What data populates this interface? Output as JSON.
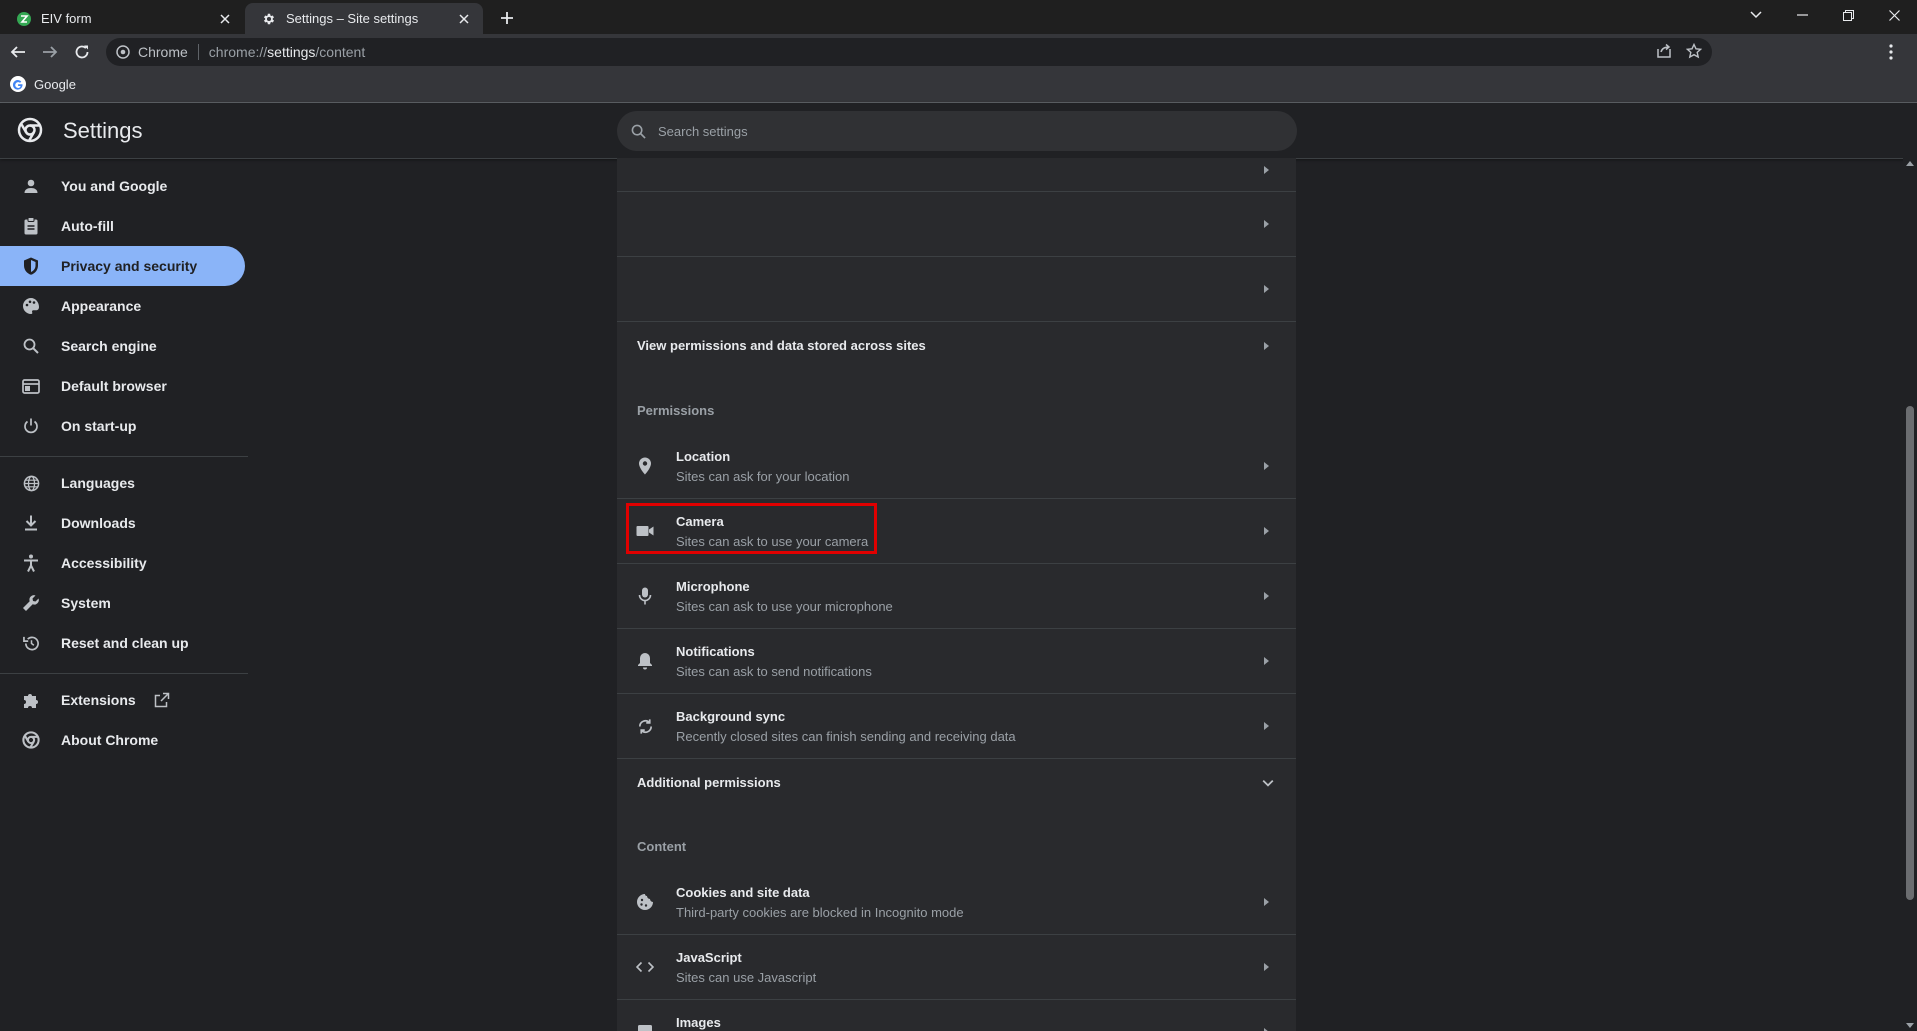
{
  "browser": {
    "tabs": [
      {
        "title": "EIV form",
        "favicon": "eiv-form-icon",
        "active": false
      },
      {
        "title": "Settings – Site settings",
        "favicon": "gear-icon",
        "active": true
      }
    ],
    "omnibox": {
      "chip_label": "Chrome",
      "url_scheme": "chrome://",
      "url_host": "settings",
      "url_path": "/content"
    },
    "bookmarks": [
      {
        "label": "Google",
        "icon": "google-icon"
      }
    ]
  },
  "settings": {
    "title": "Settings",
    "search_placeholder": "Search settings"
  },
  "sidebar": {
    "items": [
      {
        "label": "You and Google",
        "icon": "person-icon"
      },
      {
        "label": "Auto-fill",
        "icon": "clipboard-icon"
      },
      {
        "label": "Privacy and security",
        "icon": "shield-icon",
        "selected": true
      },
      {
        "label": "Appearance",
        "icon": "palette-icon"
      },
      {
        "label": "Search engine",
        "icon": "search-icon"
      },
      {
        "label": "Default browser",
        "icon": "browser-icon"
      },
      {
        "label": "On start-up",
        "icon": "power-icon"
      },
      {
        "label": "Languages",
        "icon": "globe-icon"
      },
      {
        "label": "Downloads",
        "icon": "download-icon"
      },
      {
        "label": "Accessibility",
        "icon": "accessibility-icon"
      },
      {
        "label": "System",
        "icon": "wrench-icon"
      },
      {
        "label": "Reset and clean up",
        "icon": "reset-icon"
      },
      {
        "label": "Extensions",
        "icon": "puzzle-icon"
      },
      {
        "label": "About Chrome",
        "icon": "chrome-icon"
      }
    ]
  },
  "main": {
    "view_permissions_label": "View permissions and data stored across sites",
    "permissions_heading": "Permissions",
    "permissions": [
      {
        "title": "Location",
        "subtitle": "Sites can ask for your location",
        "icon": "location-pin-icon"
      },
      {
        "title": "Camera",
        "subtitle": "Sites can ask to use your camera",
        "icon": "camera-icon",
        "highlighted": true
      },
      {
        "title": "Microphone",
        "subtitle": "Sites can ask to use your microphone",
        "icon": "microphone-icon"
      },
      {
        "title": "Notifications",
        "subtitle": "Sites can ask to send notifications",
        "icon": "bell-icon"
      },
      {
        "title": "Background sync",
        "subtitle": "Recently closed sites can finish sending and receiving data",
        "icon": "sync-icon"
      }
    ],
    "additional_permissions_label": "Additional permissions",
    "content_heading": "Content",
    "content": [
      {
        "title": "Cookies and site data",
        "subtitle": "Third-party cookies are blocked in Incognito mode",
        "icon": "cookie-icon"
      },
      {
        "title": "JavaScript",
        "subtitle": "Sites can use Javascript",
        "icon": "code-icon"
      },
      {
        "title": "Images",
        "subtitle": "",
        "icon": "image-icon"
      }
    ]
  },
  "colors": {
    "accent": "#8ab4f8",
    "highlight_border": "#e00000",
    "background": "#202124",
    "card": "#292a2d"
  }
}
